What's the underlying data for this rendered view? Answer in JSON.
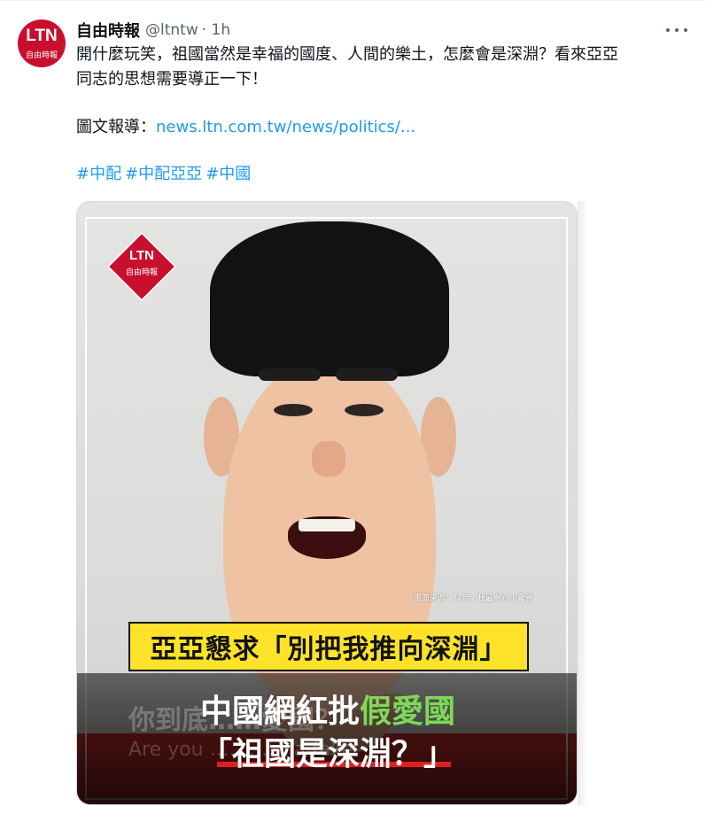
{
  "tweet": {
    "author": {
      "name": "自由時報",
      "handle": "@ltntw",
      "time": "· 1h",
      "avatar_title": "LTN",
      "avatar_subtitle": "自由時報"
    },
    "text_lines": [
      "開什麼玩笑，祖國當然是幸福的國度、人間的樂土，怎麼會是深淵？看來亞亞",
      "同志的思想需要導正一下！"
    ],
    "source_prefix": "圖文報導：",
    "link_text": "news.ltn.com.tw/news/politics/...",
    "hashtags": [
      "#中配",
      "#中配亞亞",
      "#中國"
    ],
    "media": {
      "logo_title": "LTN",
      "logo_subtitle": "自由時報",
      "credit": "畫面來源：抖音 / 我最關心小瀧哥",
      "banner": "亞亞懇求「別把我推向深淵」",
      "headline_part1": "中國網紅批",
      "headline_highlight": "假愛國",
      "headline_line2": "「祖國是深淵？」",
      "bg_subtitle_cn": "你到底……愛國？",
      "bg_subtitle_en": "Are you ………… a fake"
    }
  },
  "colors": {
    "link": "#1d9bf0",
    "brand_red": "#c8102e",
    "banner_yellow": "#fce228",
    "highlight_green": "#7ed957"
  },
  "icons": [
    "more-options-icon"
  ]
}
